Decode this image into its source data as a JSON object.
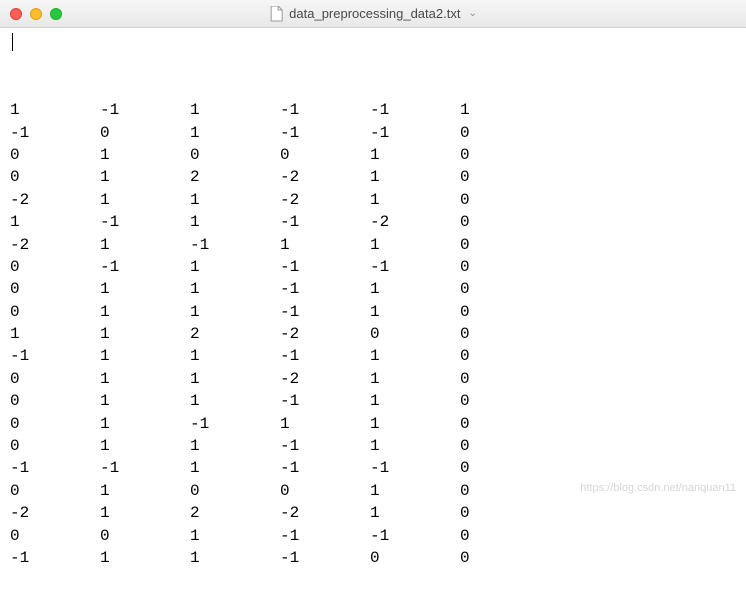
{
  "window": {
    "filename": "data_preprocessing_data2.txt"
  },
  "table": {
    "rows": [
      [
        "1",
        "-1",
        "1",
        "-1",
        "-1",
        "1"
      ],
      [
        "-1",
        "0",
        "1",
        "-1",
        "-1",
        "0"
      ],
      [
        "0",
        "1",
        "0",
        "0",
        "1",
        "0"
      ],
      [
        "0",
        "1",
        "2",
        "-2",
        "1",
        "0"
      ],
      [
        "-2",
        "1",
        "1",
        "-2",
        "1",
        "0"
      ],
      [
        "1",
        "-1",
        "1",
        "-1",
        "-2",
        "0"
      ],
      [
        "-2",
        "1",
        "-1",
        "1",
        "1",
        "0"
      ],
      [
        "0",
        "-1",
        "1",
        "-1",
        "-1",
        "0"
      ],
      [
        "0",
        "1",
        "1",
        "-1",
        "1",
        "0"
      ],
      [
        "0",
        "1",
        "1",
        "-1",
        "1",
        "0"
      ],
      [
        "1",
        "1",
        "2",
        "-2",
        "0",
        "0"
      ],
      [
        "-1",
        "1",
        "1",
        "-1",
        "1",
        "0"
      ],
      [
        "0",
        "1",
        "1",
        "-2",
        "1",
        "0"
      ],
      [
        "0",
        "1",
        "1",
        "-1",
        "1",
        "0"
      ],
      [
        "0",
        "1",
        "-1",
        "1",
        "1",
        "0"
      ],
      [
        "0",
        "1",
        "1",
        "-1",
        "1",
        "0"
      ],
      [
        "-1",
        "-1",
        "1",
        "-1",
        "-1",
        "0"
      ],
      [
        "0",
        "1",
        "0",
        "0",
        "1",
        "0"
      ],
      [
        "-2",
        "1",
        "2",
        "-2",
        "1",
        "0"
      ],
      [
        "0",
        "0",
        "1",
        "-1",
        "-1",
        "0"
      ],
      [
        "-1",
        "1",
        "1",
        "-1",
        "0",
        "0"
      ]
    ]
  },
  "watermark": "https://blog.csdn.net/nanquan11"
}
